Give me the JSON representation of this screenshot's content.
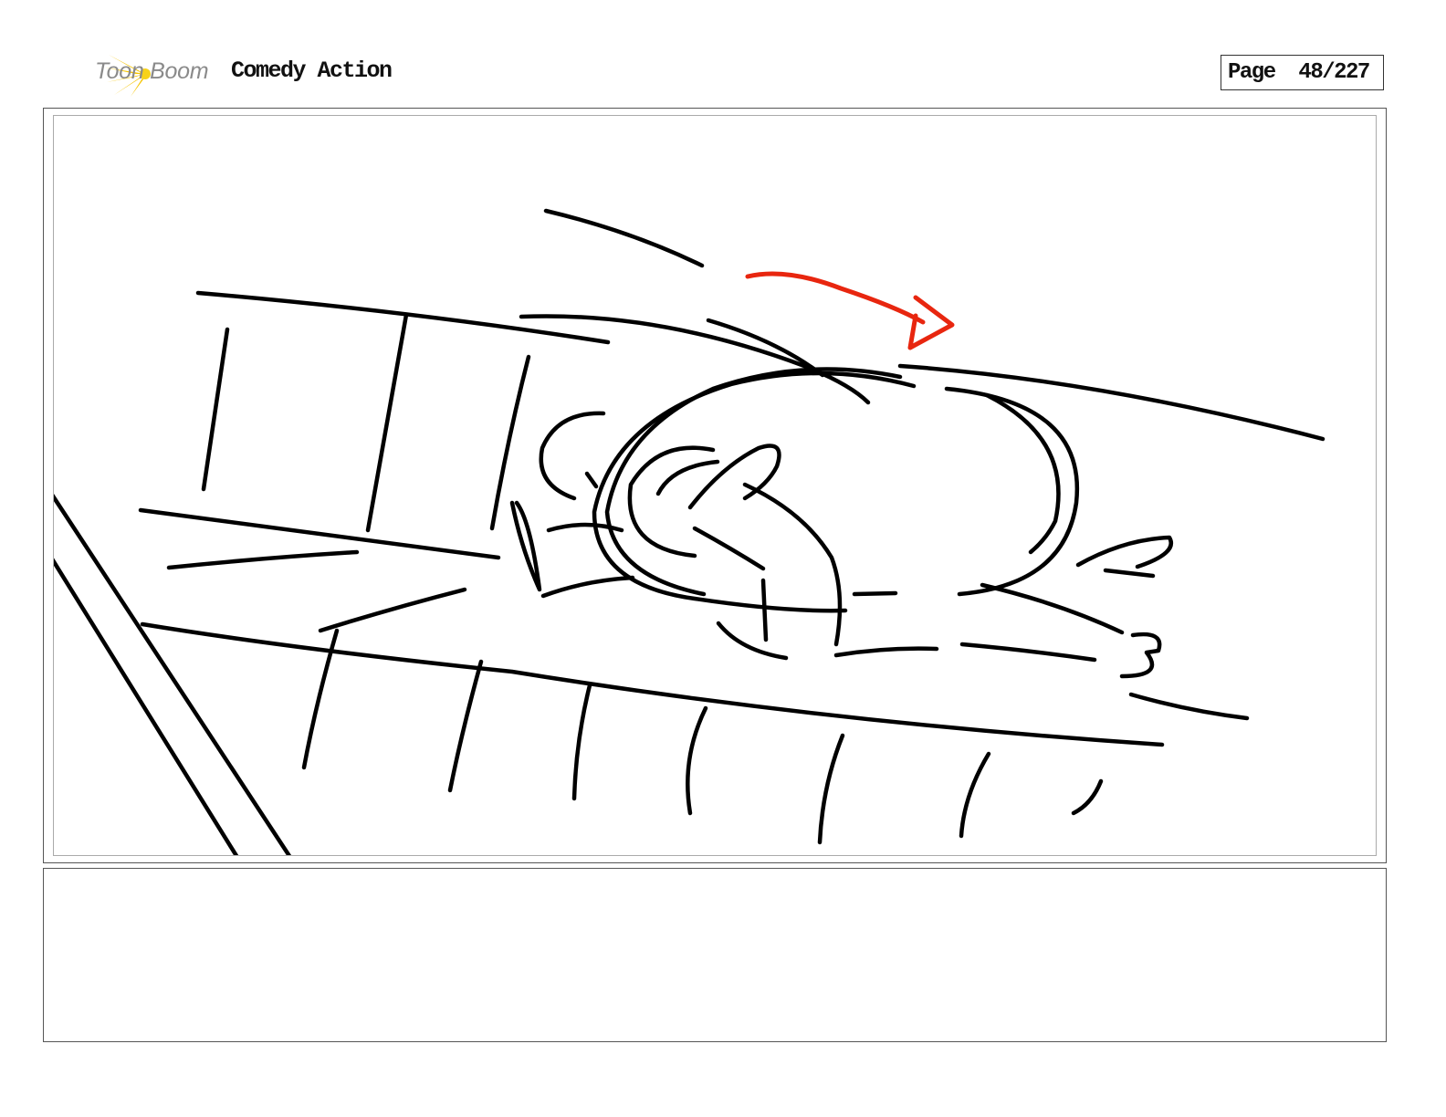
{
  "header": {
    "logo_text": "Toon Boom",
    "project_title": "Comedy Action",
    "page_indicator": "Page  48/227"
  },
  "notes": {
    "text": ""
  },
  "colors": {
    "sketch_line": "#000000",
    "motion_arrow": "#e8260f",
    "logo_flare": "#f5c400",
    "logo_text": "#8a8a8a"
  }
}
